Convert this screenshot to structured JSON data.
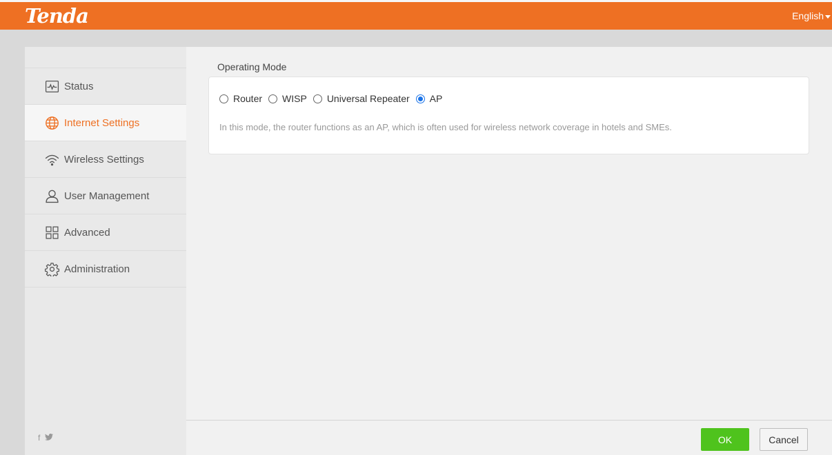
{
  "header": {
    "logo_text": "Tenda",
    "language": "English",
    "brand_color": "#ee7023"
  },
  "sidebar": {
    "items": [
      {
        "label": "Status",
        "icon": "monitor-pulse-icon",
        "active": false
      },
      {
        "label": "Internet Settings",
        "icon": "globe-icon",
        "active": true
      },
      {
        "label": "Wireless Settings",
        "icon": "wifi-icon",
        "active": false
      },
      {
        "label": "User Management",
        "icon": "user-icon",
        "active": false
      },
      {
        "label": "Advanced",
        "icon": "grid-icon",
        "active": false
      },
      {
        "label": "Administration",
        "icon": "gear-icon",
        "active": false
      }
    ],
    "social": {
      "facebook": "f",
      "twitter": "twitter-icon"
    }
  },
  "main": {
    "section_title": "Operating Mode",
    "modes": [
      {
        "label": "Router",
        "checked": false
      },
      {
        "label": "WISP",
        "checked": false
      },
      {
        "label": "Universal Repeater",
        "checked": false
      },
      {
        "label": "AP",
        "checked": true
      }
    ],
    "description": "In this mode, the router functions as an AP, which is often used for wireless network coverage in hotels and SMEs."
  },
  "footer": {
    "ok_label": "OK",
    "cancel_label": "Cancel",
    "ok_color": "#4fc31d"
  }
}
